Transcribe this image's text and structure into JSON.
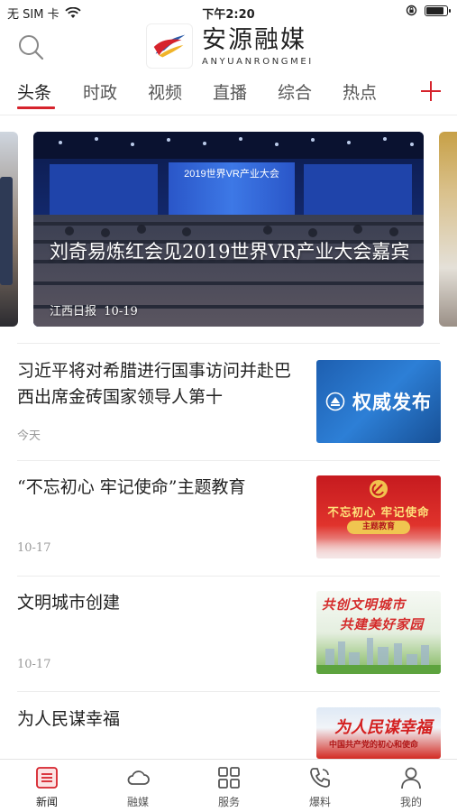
{
  "status_bar": {
    "carrier": "无 SIM 卡",
    "time": "下午2:20"
  },
  "header": {
    "app_name": "安源融媒",
    "app_name_en": "ANYUANRONGMEI"
  },
  "tabs": [
    {
      "label": "头条",
      "active": true
    },
    {
      "label": "时政",
      "active": false
    },
    {
      "label": "视频",
      "active": false
    },
    {
      "label": "直播",
      "active": false
    },
    {
      "label": "综合",
      "active": false
    },
    {
      "label": "热点",
      "active": false
    }
  ],
  "banner": {
    "title": "刘奇易炼红会见2019世界VR产业大会嘉宾",
    "source": "江西日报",
    "date": "10-19",
    "stage_text": "2019世界VR产业大会"
  },
  "news": [
    {
      "title": "习近平将对希腊进行国事访问并赴巴西出席金砖国家领导人第十",
      "date": "今天",
      "thumb_text": "权威发布"
    },
    {
      "title": "“不忘初心 牢记使命”主题教育",
      "date": "10-17",
      "thumb_text": "不忘初心 牢记使命",
      "thumb_sub": "主题教育"
    },
    {
      "title": "文明城市创建",
      "date": "10-17",
      "thumb_text": "共创文明城市",
      "thumb_sub": "共建美好家园"
    },
    {
      "title": "为人民谋幸福",
      "date": "",
      "thumb_text": "为人民谋幸福",
      "thumb_sub": "中国共产党的初心和使命"
    }
  ],
  "tabbar": [
    {
      "label": "新闻",
      "icon": "news-icon",
      "active": true
    },
    {
      "label": "融媒",
      "icon": "cloud-icon",
      "active": false
    },
    {
      "label": "服务",
      "icon": "grid-icon",
      "active": false
    },
    {
      "label": "爆料",
      "icon": "phone-icon",
      "active": false
    },
    {
      "label": "我的",
      "icon": "user-icon",
      "active": false
    }
  ],
  "colors": {
    "accent": "#d6232c",
    "text": "#222222",
    "muted": "#999999"
  }
}
